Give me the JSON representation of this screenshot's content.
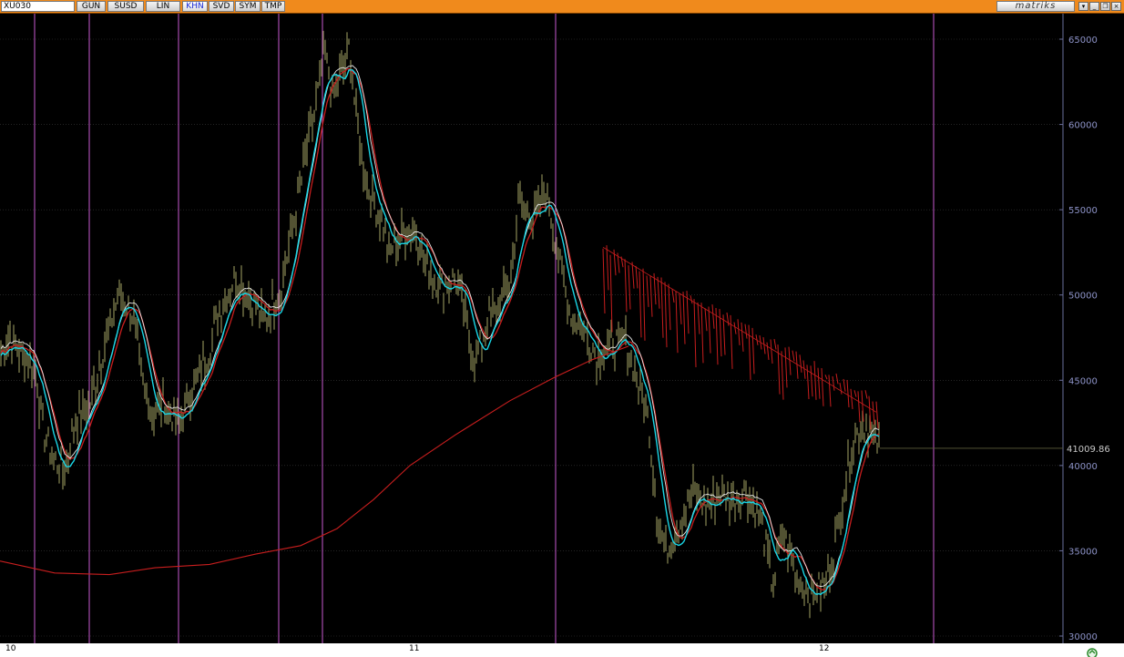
{
  "toolbar": {
    "symbol": "XU030",
    "buttons": [
      {
        "label": "GUN"
      },
      {
        "label": "SUSD"
      },
      {
        "label": "LIN"
      },
      {
        "label": "KHN",
        "active": true
      },
      {
        "label": "SVD"
      },
      {
        "label": "SYM"
      },
      {
        "label": "TMP"
      }
    ],
    "brand": "matriks",
    "window_buttons": {
      "dropdown": "▾",
      "minimize": "_",
      "restore": "❐",
      "close": "×"
    }
  },
  "chart_data": {
    "type": "line",
    "series": [],
    "x_ticks": [
      "10",
      "11",
      "12"
    ],
    "y_ticks": [
      "65000",
      "60000",
      "55000",
      "50000",
      "45000",
      "40000",
      "35000",
      "30000"
    ],
    "ylim": [
      30000,
      65500
    ],
    "last_price_label": "41009.86",
    "last_price": 41009.86,
    "grid": true,
    "colors": {
      "price_bars": "#8a8a55",
      "moving_average_fast": "#19d6e6",
      "moving_average_mid": "#e6e6e6",
      "moving_average_slow": "#c81e1e",
      "long_average": "#c81e1e",
      "period_lines": "#c95ad0",
      "grid": "#3a3a3a",
      "axis_text": "#8d93c8"
    }
  }
}
